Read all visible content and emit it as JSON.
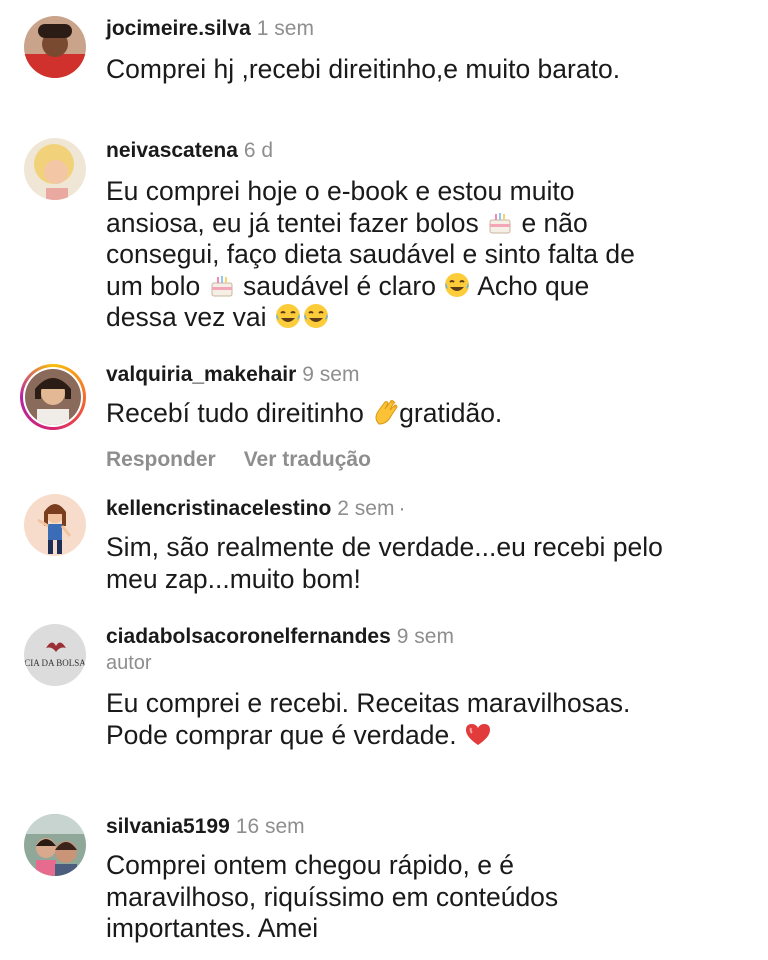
{
  "comments": [
    {
      "username": "jocimeire.silva",
      "time": "1 sem",
      "text": "Comprei hj ,recebi direitinho,e muito barato."
    },
    {
      "username": "neivascatena",
      "time": "6 d",
      "text_parts": [
        "Eu comprei hoje o e-book e estou muito ansiosa, eu já tentei fazer bolos ",
        " e não consegui, faço dieta saudável e sinto falta de um bolo ",
        " saudável é claro ",
        " Acho que dessa vez vai "
      ],
      "emojis": [
        "cake-emoji",
        "cake-emoji",
        "laughing-tears-emoji",
        "laughing-tears-emoji"
      ]
    },
    {
      "username": "valquiria_makehair",
      "time": "9 sem",
      "text_parts": [
        "Recebí tudo direitinho ",
        "gratidão."
      ],
      "emojis": [
        "clapping-hands-emoji"
      ],
      "reply_label": "Responder",
      "translate_label": "Ver tradução"
    },
    {
      "username": "kellencristinacelestino",
      "time": "2 sem",
      "dot": "·",
      "text": "Sim, são realmente de verdade...eu recebi pelo meu zap...muito bom!"
    },
    {
      "username": "ciadabolsacoronelfernandes",
      "time": "9 sem",
      "badge": "autor",
      "text": "Eu comprei e recebi. Receitas maravilhosas. Pode comprar que é verdade.",
      "emojis": [
        "red-heart-emoji"
      ],
      "avatar_text": "CIA DA BOLSA"
    },
    {
      "username": "silvania5199",
      "time": "16 sem",
      "text": "Comprei ontem chegou rápido, e é maravilhoso, riquíssimo em conteúdos importantes. Amei"
    }
  ],
  "colors": {
    "username": "#1a1a1a",
    "muted": "#8e8e8e",
    "story_ring": "#d6246e"
  }
}
